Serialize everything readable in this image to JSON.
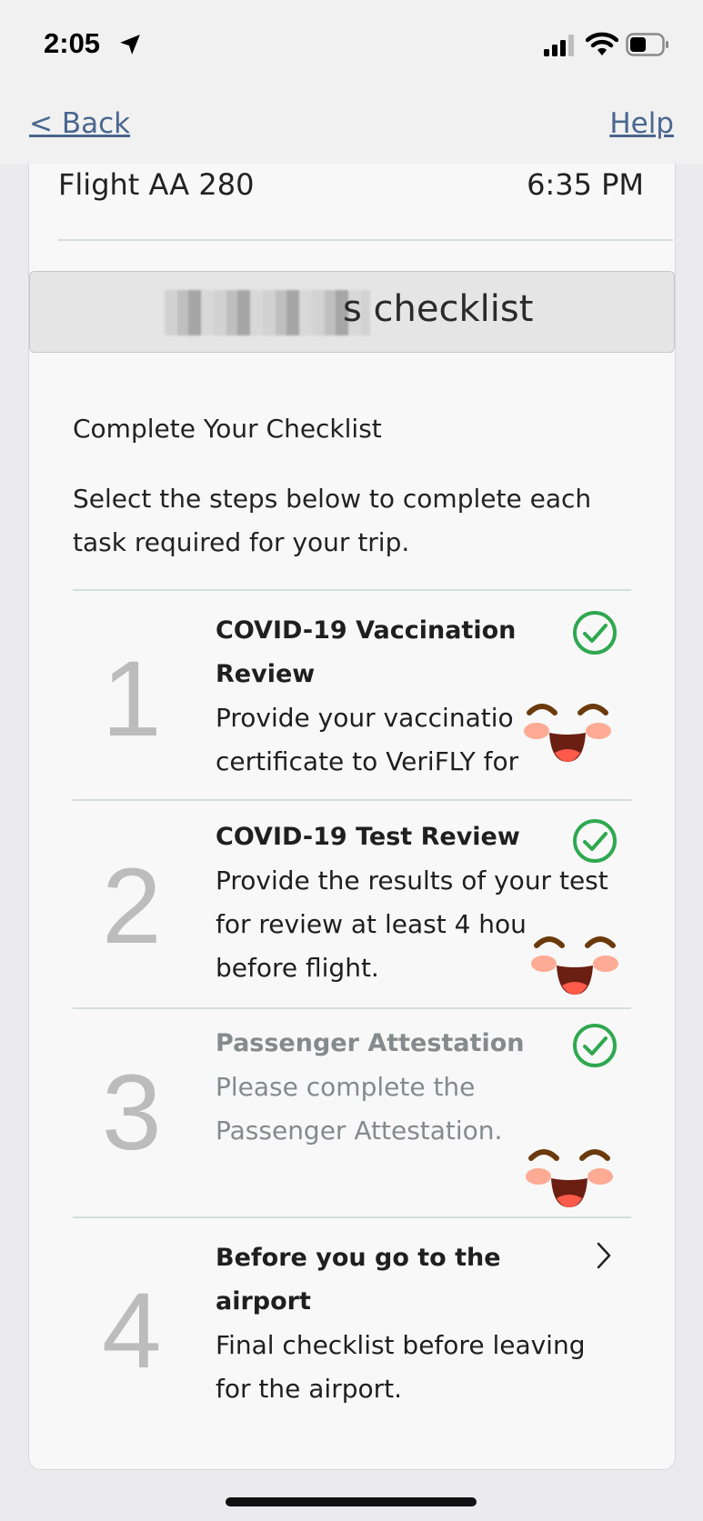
{
  "status_bar": {
    "time": "2:05"
  },
  "nav": {
    "back_label": "< Back",
    "help_label": "Help"
  },
  "flight": {
    "name": "Flight AA 280",
    "time": "6:35 PM"
  },
  "banner": {
    "title_suffix": "s checklist"
  },
  "checklist": {
    "heading": "Complete Your Checklist",
    "intro": "Select the steps below to complete each task required for your trip.",
    "steps": [
      {
        "number": "1",
        "title": "COVID-19 Vaccination Review",
        "description": "Provide your vaccinatio certificate to VeriFLY for",
        "status": "complete"
      },
      {
        "number": "2",
        "title": "COVID-19 Test Review",
        "description": "Provide the results of your test for review at least 4 hou before flight.",
        "status": "complete"
      },
      {
        "number": "3",
        "title": "Passenger Attestation",
        "description": "Please complete the Passenger Attestation.",
        "status": "complete"
      },
      {
        "number": "4",
        "title": "Before you go to the airport",
        "description": "Final checklist before leaving for the airport.",
        "status": "open"
      }
    ]
  },
  "colors": {
    "link": "#4a678e",
    "check": "#2fa84f",
    "divider": "#d4dedc"
  },
  "icons": [
    "location-arrow-icon",
    "signal-icon",
    "wifi-icon",
    "battery-icon",
    "check-circle-icon",
    "chevron-right-icon",
    "smiling-emoji-sticker"
  ]
}
